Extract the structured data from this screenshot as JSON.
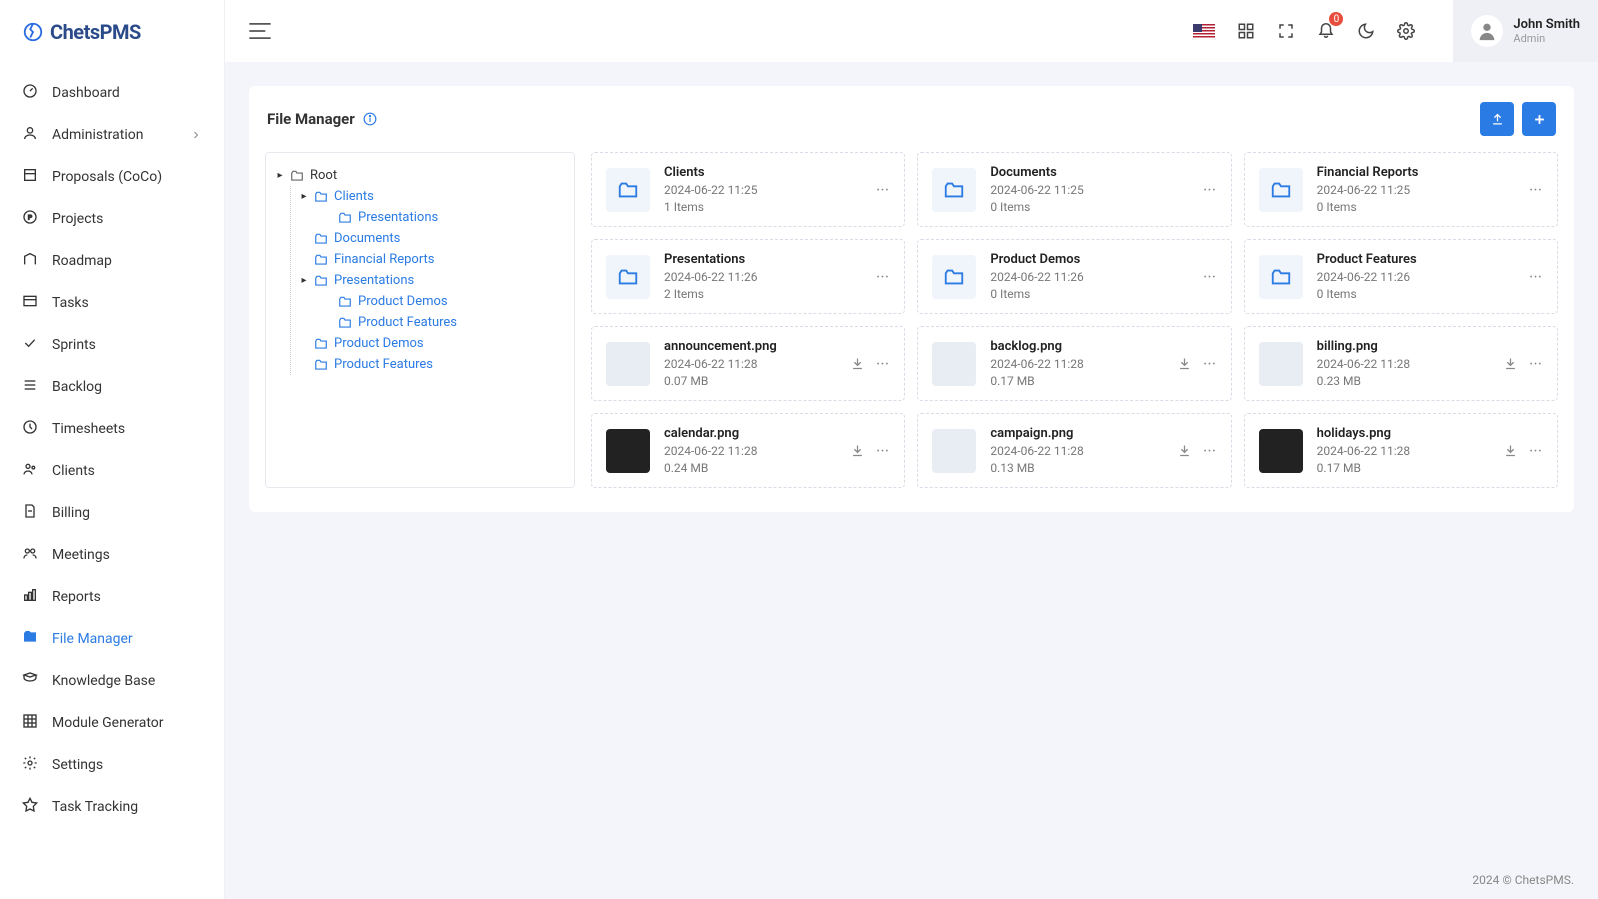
{
  "brand": "ChetsPMS",
  "sidebar": {
    "items": [
      {
        "label": "Dashboard"
      },
      {
        "label": "Administration",
        "hasSubmenu": true
      },
      {
        "label": "Proposals (CoCo)"
      },
      {
        "label": "Projects"
      },
      {
        "label": "Roadmap"
      },
      {
        "label": "Tasks"
      },
      {
        "label": "Sprints"
      },
      {
        "label": "Backlog"
      },
      {
        "label": "Timesheets"
      },
      {
        "label": "Clients"
      },
      {
        "label": "Billing"
      },
      {
        "label": "Meetings"
      },
      {
        "label": "Reports"
      },
      {
        "label": "File Manager",
        "active": true
      },
      {
        "label": "Knowledge Base"
      },
      {
        "label": "Module Generator"
      },
      {
        "label": "Settings"
      },
      {
        "label": "Task Tracking"
      }
    ]
  },
  "header": {
    "notificationCount": "0",
    "user": {
      "name": "John Smith",
      "role": "Admin"
    }
  },
  "page": {
    "title": "File Manager"
  },
  "tree": {
    "root": "Root",
    "nodes": [
      {
        "label": "Clients",
        "indent": 1,
        "hasChildren": true
      },
      {
        "label": "Presentations",
        "indent": 2
      },
      {
        "label": "Documents",
        "indent": 1
      },
      {
        "label": "Financial Reports",
        "indent": 1
      },
      {
        "label": "Presentations",
        "indent": 1,
        "hasChildren": true
      },
      {
        "label": "Product Demos",
        "indent": 2
      },
      {
        "label": "Product Features",
        "indent": 2
      },
      {
        "label": "Product Demos",
        "indent": 1
      },
      {
        "label": "Product Features",
        "indent": 1
      }
    ]
  },
  "items": [
    {
      "type": "folder",
      "name": "Clients",
      "date": "2024-06-22 11:25",
      "sub": "1 Items"
    },
    {
      "type": "folder",
      "name": "Documents",
      "date": "2024-06-22 11:25",
      "sub": "0 Items"
    },
    {
      "type": "folder",
      "name": "Financial Reports",
      "date": "2024-06-22 11:25",
      "sub": "0 Items"
    },
    {
      "type": "folder",
      "name": "Presentations",
      "date": "2024-06-22 11:26",
      "sub": "2 Items"
    },
    {
      "type": "folder",
      "name": "Product Demos",
      "date": "2024-06-22 11:26",
      "sub": "0 Items"
    },
    {
      "type": "folder",
      "name": "Product Features",
      "date": "2024-06-22 11:26",
      "sub": "0 Items"
    },
    {
      "type": "file",
      "name": "announcement.png",
      "date": "2024-06-22 11:28",
      "sub": "0.07 MB",
      "thumb": "light"
    },
    {
      "type": "file",
      "name": "backlog.png",
      "date": "2024-06-22 11:28",
      "sub": "0.17 MB",
      "thumb": "light"
    },
    {
      "type": "file",
      "name": "billing.png",
      "date": "2024-06-22 11:28",
      "sub": "0.23 MB",
      "thumb": "light"
    },
    {
      "type": "file",
      "name": "calendar.png",
      "date": "2024-06-22 11:28",
      "sub": "0.24 MB",
      "thumb": "dark"
    },
    {
      "type": "file",
      "name": "campaign.png",
      "date": "2024-06-22 11:28",
      "sub": "0.13 MB",
      "thumb": "light"
    },
    {
      "type": "file",
      "name": "holidays.png",
      "date": "2024-06-22 11:28",
      "sub": "0.17 MB",
      "thumb": "dark"
    }
  ],
  "footer": "2024 © ChetsPMS."
}
